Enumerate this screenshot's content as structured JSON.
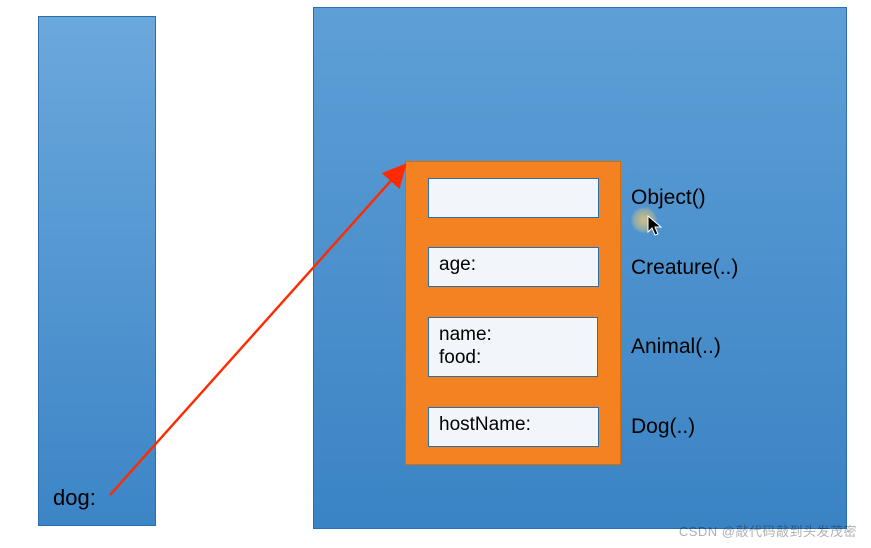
{
  "left": {
    "variable_label": "dog:"
  },
  "object_box": {
    "fields": [
      {
        "text": ""
      },
      {
        "text": "age:"
      },
      {
        "text": "name:\nfood:"
      },
      {
        "text": "hostName:"
      }
    ],
    "classes": [
      {
        "label": "Object()"
      },
      {
        "label": "Creature(..)"
      },
      {
        "label": "Animal(..)"
      },
      {
        "label": "Dog(..)"
      }
    ]
  },
  "watermark": "CSDN @敲代码敲到头发茂密"
}
